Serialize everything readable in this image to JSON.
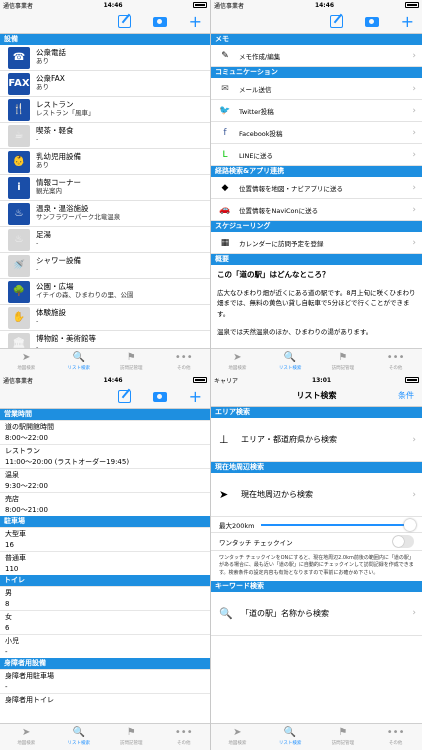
{
  "panel1": {
    "status": {
      "carrier": "通信事業者",
      "time": "14:46"
    },
    "section": "設備",
    "facilities": [
      {
        "name": "公衆電話",
        "value": "あり",
        "icon": "phone-icon",
        "glyph": "☎",
        "on": true
      },
      {
        "name": "公衆FAX",
        "value": "あり",
        "icon": "fax-icon",
        "glyph": "FAX",
        "on": true
      },
      {
        "name": "レストラン",
        "value": "レストラン「風車」",
        "icon": "restaurant-icon",
        "glyph": "🍴",
        "on": true
      },
      {
        "name": "喫茶・軽食",
        "value": "-",
        "icon": "cafe-icon",
        "glyph": "☕",
        "on": false
      },
      {
        "name": "乳幼児用設備",
        "value": "あり",
        "icon": "baby-icon",
        "glyph": "👶",
        "on": true
      },
      {
        "name": "情報コーナー",
        "value": "観光案内",
        "icon": "info-icon",
        "glyph": "i",
        "on": true
      },
      {
        "name": "温泉・温浴施設",
        "value": "サンフラワーパーク北竜温泉",
        "icon": "hot-spring-icon",
        "glyph": "♨",
        "on": true
      },
      {
        "name": "足湯",
        "value": "-",
        "icon": "foot-bath-icon",
        "glyph": "♨",
        "on": false
      },
      {
        "name": "シャワー設備",
        "value": "-",
        "icon": "shower-icon",
        "glyph": "🚿",
        "on": false
      },
      {
        "name": "公園・広場",
        "value": "イチイの森、ひまわりの里、公園",
        "icon": "park-icon",
        "glyph": "🌳",
        "on": true
      },
      {
        "name": "体験施設",
        "value": "-",
        "icon": "experience-icon",
        "glyph": "✋",
        "on": false
      },
      {
        "name": "博物館・美術館等",
        "value": "-",
        "icon": "museum-icon",
        "glyph": "🏛",
        "on": false
      }
    ]
  },
  "panel2": {
    "status": {
      "carrier": "通信事業者",
      "time": "14:46"
    },
    "memo_section": "メモ",
    "memo_item": "メモ作成/編集",
    "comm_section": "コミュニケーション",
    "comm_items": [
      {
        "label": "メール送信",
        "icon": "mail-icon",
        "glyph": "✉",
        "color": "#555555"
      },
      {
        "label": "Twitter投稿",
        "icon": "twitter-icon",
        "glyph": "🐦",
        "color": "#1da1f2"
      },
      {
        "label": "Facebook投稿",
        "icon": "facebook-icon",
        "glyph": "f",
        "color": "#3b5998"
      },
      {
        "label": "LINEに送る",
        "icon": "line-icon",
        "glyph": "L",
        "color": "#00c300"
      }
    ],
    "route_section": "経路検索&アプリ連携",
    "route_items": [
      {
        "label": "位置情報を地図・ナビアプリに送る",
        "icon": "navigate-icon",
        "glyph": "◆"
      },
      {
        "label": "位置情報をNaviConに送る",
        "icon": "navicon-icon",
        "glyph": "🚗"
      }
    ],
    "schedule_section": "スケジューリング",
    "schedule_item": "カレンダーに訪問予定を登録",
    "about_section": "概要",
    "about_title": "この「道の駅」はどんなところ？",
    "about_p1": "広大なひまわり畑が近くにある道の駅です。8月上旬に咲くひまわり畑までは、無料の黄色い貸し自転車で5分ほどで行くことができます。",
    "about_p2": "温泉では天然温泉のほか、ひまわりの湯があります。"
  },
  "panel3": {
    "status": {
      "carrier": "通信事業者",
      "time": "14:46"
    },
    "hours_section": "営業時間",
    "hours": [
      {
        "k": "道の駅開館時間",
        "v": "8:00～22:00"
      },
      {
        "k": "レストラン",
        "v": "11:00～20:00 (ラストオーダー19:45)"
      },
      {
        "k": "温泉",
        "v": "9:30～22:00"
      },
      {
        "k": "売店",
        "v": "8:00～21:00"
      }
    ],
    "parking_section": "駐車場",
    "parking": [
      {
        "k": "大型車",
        "v": "16"
      },
      {
        "k": "普通車",
        "v": "110"
      }
    ],
    "toilet_section": "トイレ",
    "toilet": [
      {
        "k": "男",
        "v": "8"
      },
      {
        "k": "女",
        "v": "6"
      },
      {
        "k": "小児",
        "v": "-"
      }
    ],
    "disabled_section": "身障者用設備",
    "disabled": [
      {
        "k": "身障者用駐車場",
        "v": "-"
      },
      {
        "k": "身障者用トイレ",
        "v": ""
      }
    ]
  },
  "panel4": {
    "status": {
      "carrier": "キャリア",
      "time": "13:01"
    },
    "title": "リスト検索",
    "conditions_button": "条件",
    "area_section": "エリア検索",
    "area_item": "エリア・都道府県から検索",
    "nearby_section": "現在地周辺検索",
    "nearby_item": "現在地周辺から検索",
    "radius_label": "最大200km",
    "radius_fraction": 0.95,
    "checkin_label": "ワンタッチ チェックイン",
    "checkin_note": "ワンタッチ チェックインをONにすると、現在地周辺2.0km前後の範囲内に「道の駅」がある場合に、最も近い「道の駅」に自動的にチェックインして訪問記録を作成できます。検索条件の設定内容も有効となりますので事前にお確かめ下さい。",
    "keyword_section": "キーワード検索",
    "keyword_item": "「道の駅」名称から検索"
  },
  "tabs": [
    {
      "label": "地図検索",
      "icon": "map-arrow-icon",
      "glyph": "➤"
    },
    {
      "label": "リスト検索",
      "icon": "search-icon",
      "glyph": "🔍"
    },
    {
      "label": "訪問記管理",
      "icon": "flag-icon",
      "glyph": "⚑"
    },
    {
      "label": "その他",
      "icon": "more-icon",
      "glyph": "•••"
    }
  ]
}
